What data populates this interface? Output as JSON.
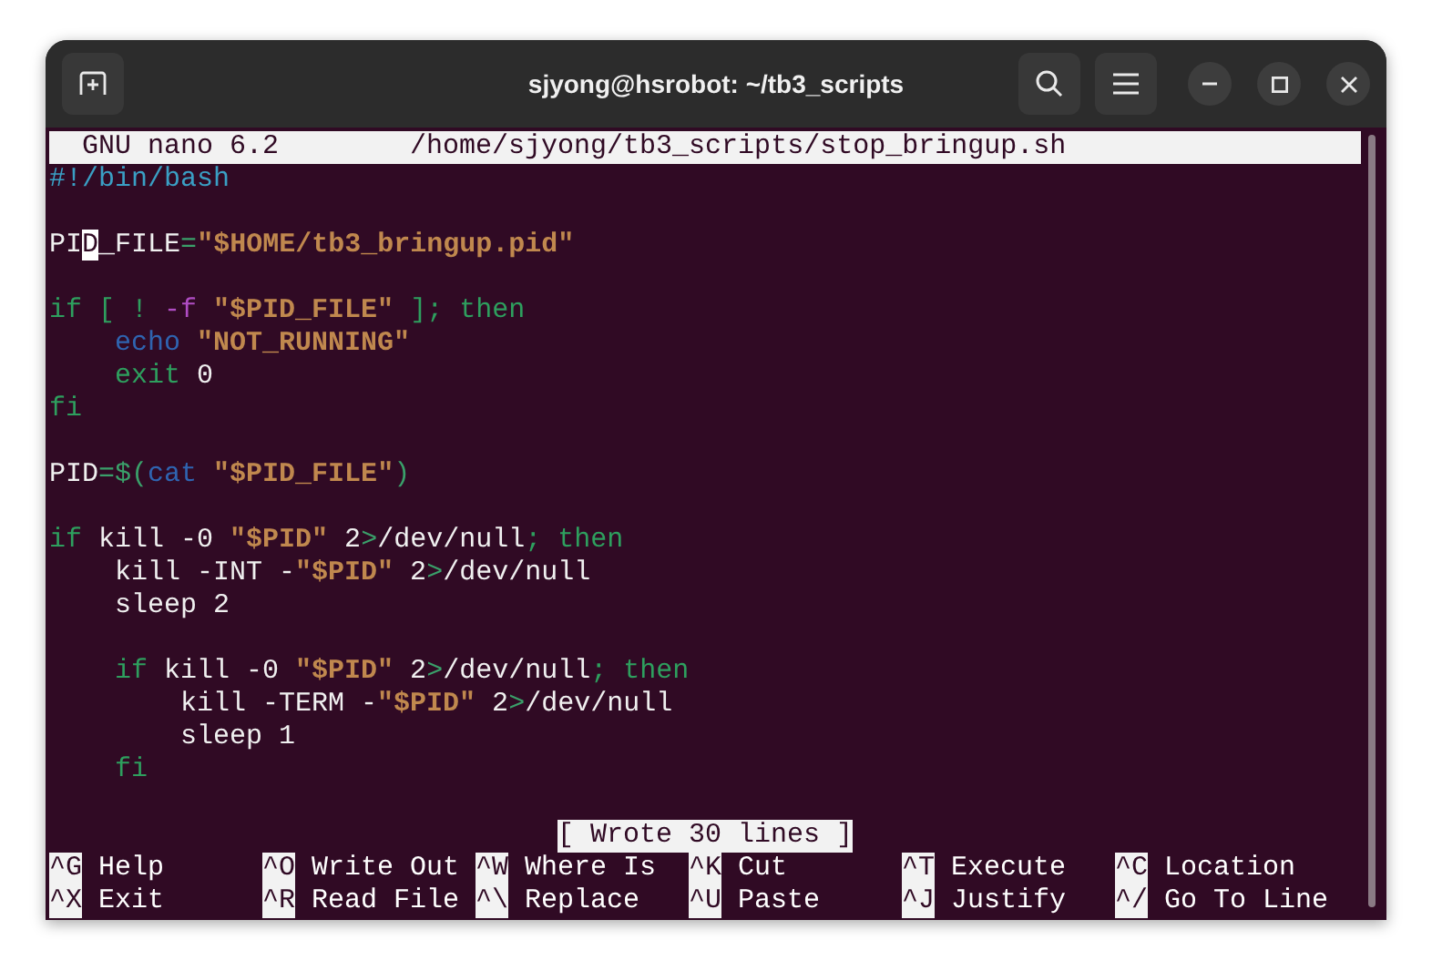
{
  "window": {
    "title": "sjyong@hsrobot: ~/tb3_scripts"
  },
  "nano": {
    "version": "GNU nano 6.2",
    "file_path": "/home/sjyong/tb3_scripts/stop_bringup.sh",
    "status": "[ Wrote 30 lines ]"
  },
  "lines": [
    {
      "kind": "code",
      "tokens": [
        {
          "kind": "comment",
          "text": "#!/bin/bash"
        }
      ]
    },
    {
      "kind": "blank"
    },
    {
      "kind": "code",
      "tokens": [
        {
          "kind": "plain",
          "text": "PI"
        },
        {
          "kind": "cursor",
          "text": "D"
        },
        {
          "kind": "plain",
          "text": "_FILE"
        },
        {
          "kind": "op",
          "text": "="
        },
        {
          "kind": "string",
          "text": "\"$HOME/tb3_bringup.pid\""
        }
      ]
    },
    {
      "kind": "blank"
    },
    {
      "kind": "code",
      "tokens": [
        {
          "kind": "keyword",
          "text": "if [ ! "
        },
        {
          "kind": "flag",
          "text": "-f"
        },
        {
          "kind": "string",
          "text": " \"$PID_FILE\""
        },
        {
          "kind": "keyword",
          "text": " ]; then"
        }
      ]
    },
    {
      "kind": "code",
      "tokens": [
        {
          "kind": "builtin",
          "text": "    echo"
        },
        {
          "kind": "string",
          "text": " \"NOT_RUNNING\""
        }
      ]
    },
    {
      "kind": "code",
      "tokens": [
        {
          "kind": "keyword",
          "text": "    exit"
        },
        {
          "kind": "plain",
          "text": " 0"
        }
      ]
    },
    {
      "kind": "code",
      "tokens": [
        {
          "kind": "keyword",
          "text": "fi"
        }
      ]
    },
    {
      "kind": "blank"
    },
    {
      "kind": "code",
      "tokens": [
        {
          "kind": "plain",
          "text": "PID"
        },
        {
          "kind": "op",
          "text": "=$("
        },
        {
          "kind": "builtin",
          "text": "cat"
        },
        {
          "kind": "string",
          "text": " \"$PID_FILE\""
        },
        {
          "kind": "op",
          "text": ")"
        }
      ]
    },
    {
      "kind": "blank"
    },
    {
      "kind": "code",
      "tokens": [
        {
          "kind": "keyword",
          "text": "if"
        },
        {
          "kind": "plain",
          "text": " kill -0 "
        },
        {
          "kind": "string",
          "text": "\"$PID\""
        },
        {
          "kind": "plain",
          "text": " 2"
        },
        {
          "kind": "op",
          "text": ">"
        },
        {
          "kind": "plain",
          "text": "/dev/null"
        },
        {
          "kind": "keyword",
          "text": "; then"
        }
      ]
    },
    {
      "kind": "code",
      "tokens": [
        {
          "kind": "plain",
          "text": "    kill -INT -"
        },
        {
          "kind": "string",
          "text": "\"$PID\""
        },
        {
          "kind": "plain",
          "text": " 2"
        },
        {
          "kind": "op",
          "text": ">"
        },
        {
          "kind": "plain",
          "text": "/dev/null"
        }
      ]
    },
    {
      "kind": "code",
      "tokens": [
        {
          "kind": "plain",
          "text": "    sleep 2"
        }
      ]
    },
    {
      "kind": "blank"
    },
    {
      "kind": "code",
      "tokens": [
        {
          "kind": "keyword",
          "text": "    if"
        },
        {
          "kind": "plain",
          "text": " kill -0 "
        },
        {
          "kind": "string",
          "text": "\"$PID\""
        },
        {
          "kind": "plain",
          "text": " 2"
        },
        {
          "kind": "op",
          "text": ">"
        },
        {
          "kind": "plain",
          "text": "/dev/null"
        },
        {
          "kind": "keyword",
          "text": "; then"
        }
      ]
    },
    {
      "kind": "code",
      "tokens": [
        {
          "kind": "plain",
          "text": "        kill -TERM -"
        },
        {
          "kind": "string",
          "text": "\"$PID\""
        },
        {
          "kind": "plain",
          "text": " 2"
        },
        {
          "kind": "op",
          "text": ">"
        },
        {
          "kind": "plain",
          "text": "/dev/null"
        }
      ]
    },
    {
      "kind": "code",
      "tokens": [
        {
          "kind": "plain",
          "text": "        sleep 1"
        }
      ]
    },
    {
      "kind": "code",
      "tokens": [
        {
          "kind": "keyword",
          "text": "    fi"
        }
      ]
    },
    {
      "kind": "blank"
    }
  ],
  "shortcuts": [
    {
      "key": "^G",
      "label": "Help"
    },
    {
      "key": "^X",
      "label": "Exit"
    },
    {
      "key": "^O",
      "label": "Write Out"
    },
    {
      "key": "^R",
      "label": "Read File"
    },
    {
      "key": "^W",
      "label": "Where Is"
    },
    {
      "key": "^\\",
      "label": "Replace"
    },
    {
      "key": "^K",
      "label": "Cut"
    },
    {
      "key": "^U",
      "label": "Paste"
    },
    {
      "key": "^T",
      "label": "Execute"
    },
    {
      "key": "^J",
      "label": "Justify"
    },
    {
      "key": "^C",
      "label": "Location"
    },
    {
      "key": "^/",
      "label": "Go To Line"
    }
  ]
}
